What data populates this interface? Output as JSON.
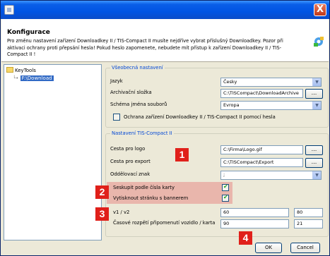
{
  "titlebar": {
    "close_glyph": "X"
  },
  "header": {
    "title": "Konfigurace",
    "description": "Pro změnu nastavení zařízení Downloadkey II / TIS-Compact II musíte nejdříve vybrat příslušný Downloadkey. Pozor při aktivaci ochrany proti přepsání hesla! Pokud heslo zapomenete, nebudete mít přístup k zařízení Downloadkey II / TIS-Compact II !"
  },
  "tree": {
    "root_label": "KeyTools",
    "child_label": "F:\\Download"
  },
  "general": {
    "title": "Všeobecná nastavení",
    "language_label": "Jazyk",
    "language_value": "Česky",
    "archive_label": "Archivační složka",
    "archive_value": "C:\\TISCompact\\DownloadArchive",
    "schema_label": "Schéma jména souborů",
    "schema_value": "Evropa",
    "protect_label": "Ochrana zařízení Downloadkey II / TIS-Compact II pomocí hesla",
    "browse_label": "..."
  },
  "tis": {
    "title": "Nastavení TIS-Compact II",
    "logo_label": "Cesta pro logo",
    "logo_value": "C:\\Firma\\Logo.gif",
    "export_label": "Cesta pro export",
    "export_value": "C:\\TISCompact\\Export",
    "separator_label": "Oddělovací znak",
    "separator_value": ";",
    "group_label": "Seskupit podle čísla karty",
    "banner_label": "Vytisknout stránku s bannerem",
    "v_label": "v1 / v2",
    "v1": "60",
    "v2": "80",
    "interval_label": "Časové rozpětí připomenutí vozidlo / karta",
    "interval1": "90",
    "interval2": "21",
    "browse_label": "..."
  },
  "badges": [
    "1",
    "2",
    "3",
    "4"
  ],
  "buttons": {
    "ok": "OK",
    "cancel": "Cancel"
  },
  "colors": {
    "badge": "#e0201a",
    "highlight": "#e67878",
    "group_title": "#0046d5"
  }
}
